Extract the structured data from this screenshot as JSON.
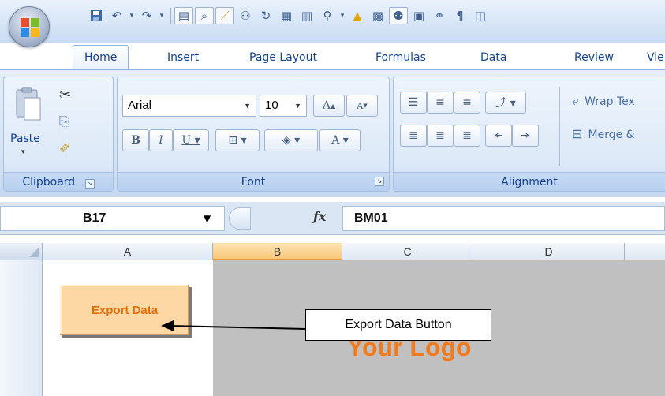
{
  "quick_access": {
    "icons": [
      "save-icon",
      "undo-icon",
      "redo-icon"
    ]
  },
  "tabs": [
    {
      "label": "Home",
      "active": true
    },
    {
      "label": "Insert"
    },
    {
      "label": "Page Layout"
    },
    {
      "label": "Formulas"
    },
    {
      "label": "Data"
    },
    {
      "label": "Review"
    },
    {
      "label": "Vie"
    }
  ],
  "ribbon": {
    "clipboard": {
      "paste_label": "Paste",
      "group_label": "Clipboard"
    },
    "font": {
      "font_name": "Arial",
      "font_size": "10",
      "group_label": "Font"
    },
    "alignment": {
      "wrap_text": "Wrap Tex",
      "merge": "Merge &",
      "group_label": "Alignment"
    }
  },
  "formula_bar": {
    "name_box": "B17",
    "fx_label": "fx",
    "formula": "BM01"
  },
  "columns": [
    "A",
    "B",
    "C",
    "D"
  ],
  "selected_column": "B",
  "sheet": {
    "export_button": "Export Data",
    "callout_label": "Export Data Button",
    "logo_text": "Your Logo"
  },
  "colors": {
    "export_button_bg": "#fdd8a5",
    "export_button_text": "#e36c09",
    "logo_text": "#f07a1e",
    "selected_column_header": "#f8c878"
  }
}
